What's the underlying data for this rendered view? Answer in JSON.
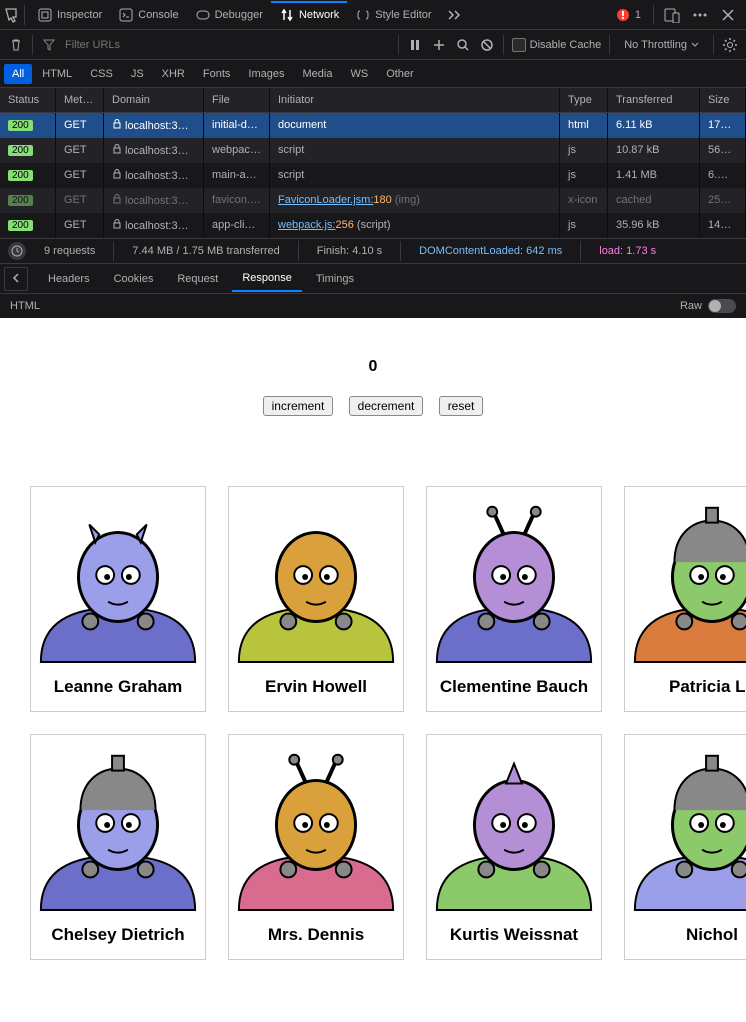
{
  "devtools": {
    "mainTabs": {
      "inspector": "Inspector",
      "console": "Console",
      "debugger": "Debugger",
      "network": "Network",
      "styleEditor": "Style Editor"
    },
    "warningCount": "1",
    "filterPlaceholder": "Filter URLs",
    "disableCache": "Disable Cache",
    "throttling": "No Throttling"
  },
  "filterTabs": {
    "all": "All",
    "html": "HTML",
    "css": "CSS",
    "js": "JS",
    "xhr": "XHR",
    "fonts": "Fonts",
    "images": "Images",
    "media": "Media",
    "ws": "WS",
    "other": "Other"
  },
  "tableHeaders": {
    "status": "Status",
    "method": "Meth…",
    "domain": "Domain",
    "file": "File",
    "initiator": "Initiator",
    "type": "Type",
    "transferred": "Transferred",
    "size": "Size"
  },
  "requests": [
    {
      "status": "200",
      "method": "GET",
      "domain": "localhost:3…",
      "file": "initial-data",
      "initiator": "document",
      "type": "html",
      "transferred": "6.11 kB",
      "size": "17…",
      "selected": true
    },
    {
      "status": "200",
      "method": "GET",
      "domain": "localhost:3…",
      "file": "webpack.js",
      "initiator": "script",
      "type": "js",
      "transferred": "10.87 kB",
      "size": "56…"
    },
    {
      "status": "200",
      "method": "GET",
      "domain": "localhost:3…",
      "file": "main-app.js",
      "initiator": "script",
      "type": "js",
      "transferred": "1.41 MB",
      "size": "6.…"
    },
    {
      "status": "200",
      "method": "GET",
      "domain": "localhost:3…",
      "file": "favicon.ico",
      "initiatorLink": "FaviconLoader.jsm:",
      "initiatorLine": "180",
      "initiatorSuffix": " (img)",
      "type": "x-icon",
      "transferred": "cached",
      "size": "25…",
      "faded": true
    },
    {
      "status": "200",
      "method": "GET",
      "domain": "localhost:3…",
      "file": "app-client-i",
      "initiatorLink": "webpack.js:",
      "initiatorLine": "256",
      "initiatorSuffix": " (script)",
      "type": "js",
      "transferred": "35.96 kB",
      "size": "14…"
    }
  ],
  "summary": {
    "requests": "9 requests",
    "transferred": "7.44 MB / 1.75 MB transferred",
    "finish": "Finish: 4.10 s",
    "dcl": "DOMContentLoaded: 642 ms",
    "load": "load: 1.73 s"
  },
  "detailTabs": {
    "headers": "Headers",
    "cookies": "Cookies",
    "request": "Request",
    "response": "Response",
    "timings": "Timings"
  },
  "response": {
    "typeLabel": "HTML",
    "rawLabel": "Raw"
  },
  "page": {
    "counter": "0",
    "buttons": {
      "increment": "increment",
      "decrement": "decrement",
      "reset": "reset"
    },
    "users": [
      {
        "name": "Leanne Graham"
      },
      {
        "name": "Ervin Howell"
      },
      {
        "name": "Clementine Bauch"
      },
      {
        "name": "Patricia Le"
      },
      {
        "name": "Chelsey Dietrich"
      },
      {
        "name": "Mrs. Dennis"
      },
      {
        "name": "Kurtis Weissnat"
      },
      {
        "name": "Nichol"
      }
    ]
  }
}
